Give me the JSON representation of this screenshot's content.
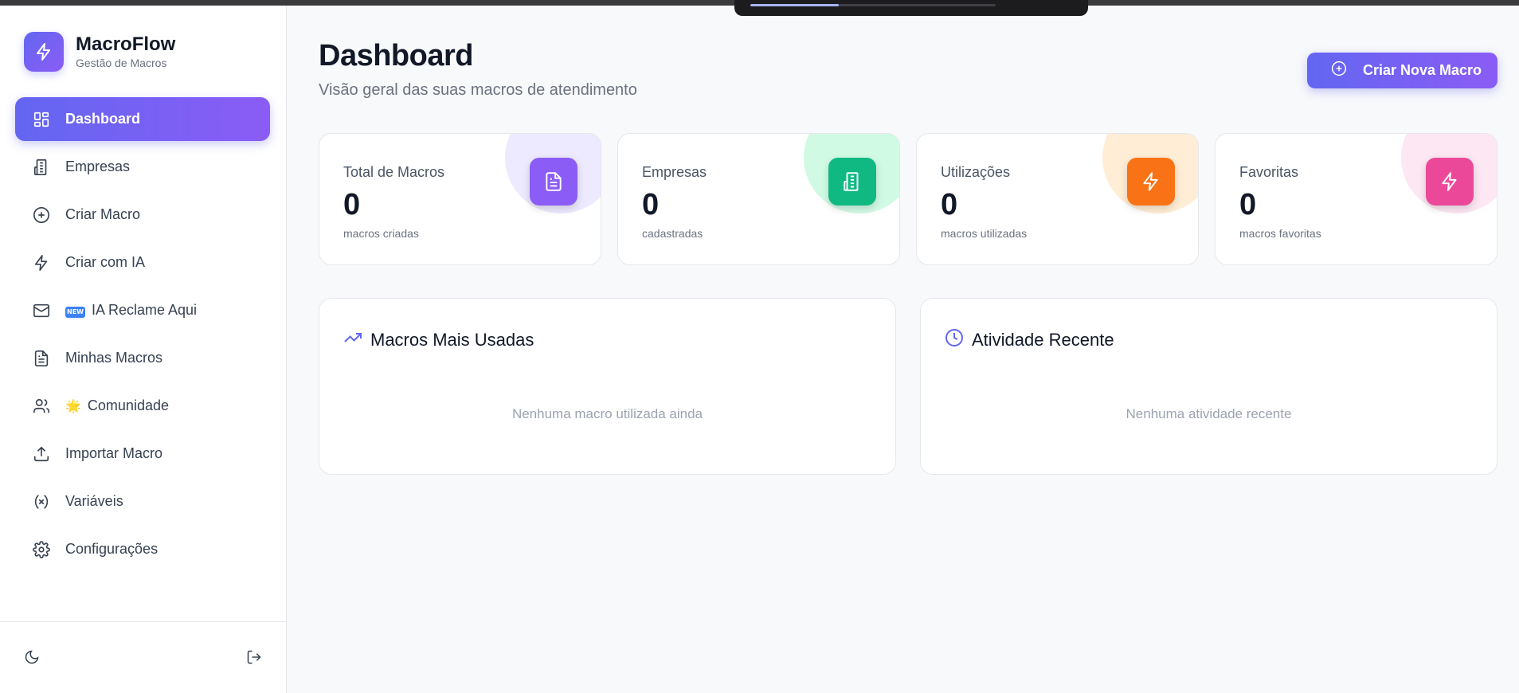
{
  "brand": {
    "name": "MacroFlow",
    "subtitle": "Gestão de Macros",
    "icon": "lightning-icon"
  },
  "top_bar": {
    "progress": 0.36
  },
  "sidebar": {
    "items": [
      {
        "label": "Dashboard",
        "icon": "grid-icon",
        "active": true
      },
      {
        "label": "Empresas",
        "icon": "building-icon"
      },
      {
        "label": "Criar Macro",
        "icon": "plus-circle-icon"
      },
      {
        "label": "Criar com IA",
        "icon": "lightning-icon"
      },
      {
        "label": "IA Reclame Aqui",
        "icon": "mail-icon",
        "badge": "NEW"
      },
      {
        "label": "Minhas Macros",
        "icon": "document-icon"
      },
      {
        "label": "Comunidade",
        "icon": "users-icon",
        "emoji": "🌟"
      },
      {
        "label": "Importar Macro",
        "icon": "upload-icon"
      },
      {
        "label": "Variáveis",
        "icon": "variable-icon"
      },
      {
        "label": "Configurações",
        "icon": "gear-icon"
      }
    ],
    "footer": {
      "theme_icon": "moon-icon",
      "logout_icon": "logout-icon"
    }
  },
  "header": {
    "title": "Dashboard",
    "subtitle": "Visão geral das suas macros de atendimento",
    "create_button": "Criar Nova Macro"
  },
  "stats": [
    {
      "title": "Total de Macros",
      "value": "0",
      "sub": "macros criadas",
      "icon": "document-icon",
      "color": "#8b5cf6",
      "blob": "#ede9fe"
    },
    {
      "title": "Empresas",
      "value": "0",
      "sub": "cadastradas",
      "icon": "building-icon",
      "color": "#10b981",
      "blob": "#d1fae5"
    },
    {
      "title": "Utilizações",
      "value": "0",
      "sub": "macros utilizadas",
      "icon": "lightning-icon",
      "color": "#f97316",
      "blob": "#ffedd5"
    },
    {
      "title": "Favoritas",
      "value": "0",
      "sub": "macros favoritas",
      "icon": "lightning-icon",
      "color": "#ec4899",
      "blob": "#fce7f3"
    }
  ],
  "panels": {
    "most_used": {
      "title": "Macros Mais Usadas",
      "empty": "Nenhuma macro utilizada ainda",
      "icon": "trending-up-icon"
    },
    "recent": {
      "title": "Atividade Recente",
      "empty": "Nenhuma atividade recente",
      "icon": "clock-icon"
    }
  },
  "colors": {
    "accent": "#6366f1",
    "accent_end": "#8b5cf6"
  }
}
